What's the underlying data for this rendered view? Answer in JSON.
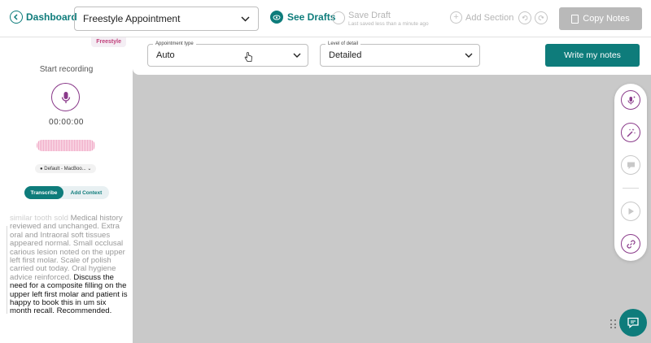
{
  "header": {
    "back_label": "Dashboard",
    "appointment_select": "Freestyle Appointment",
    "see_drafts": "See Drafts",
    "save_draft": "Save Draft",
    "save_status": "Last saved less than a minute ago",
    "add_section": "Add Section",
    "copy_notes": "Copy Notes"
  },
  "left": {
    "tag": "Freestyle",
    "start_recording": "Start recording",
    "timer": "00:00:00",
    "device": "Default - MacBoo...",
    "mode_tabs": [
      "Transcribe",
      "Add Context"
    ],
    "transcript_clipped": "similar tooth sold ",
    "transcript_faded": "Medical history reviewed and unchanged. Extra oral and Intraoral soft tissues appeared normal. Small occlusal carious lesion noted on the upper left first molar. Scale of polish carried out today. Oral hygiene advice reinforced.",
    "transcript_recent": "Discuss the need for a composite filling on the upper left first molar and patient is happy to book this in um six month recall. Recommended."
  },
  "settings": {
    "appointment_type_label": "Appointment type",
    "appointment_type_value": "Auto",
    "detail_label": "Level of detail",
    "detail_value": "Detailed",
    "write_button": "Write my notes"
  },
  "toolbar_icons": [
    "mic-sparkle-icon",
    "magic-wand-icon",
    "comment-icon",
    "play-icon",
    "link-icon"
  ],
  "colors": {
    "primary": "#0e7c7b",
    "accent": "#8a3a8a",
    "pink": "#c2407b",
    "disabled": "#b9b9b9"
  }
}
